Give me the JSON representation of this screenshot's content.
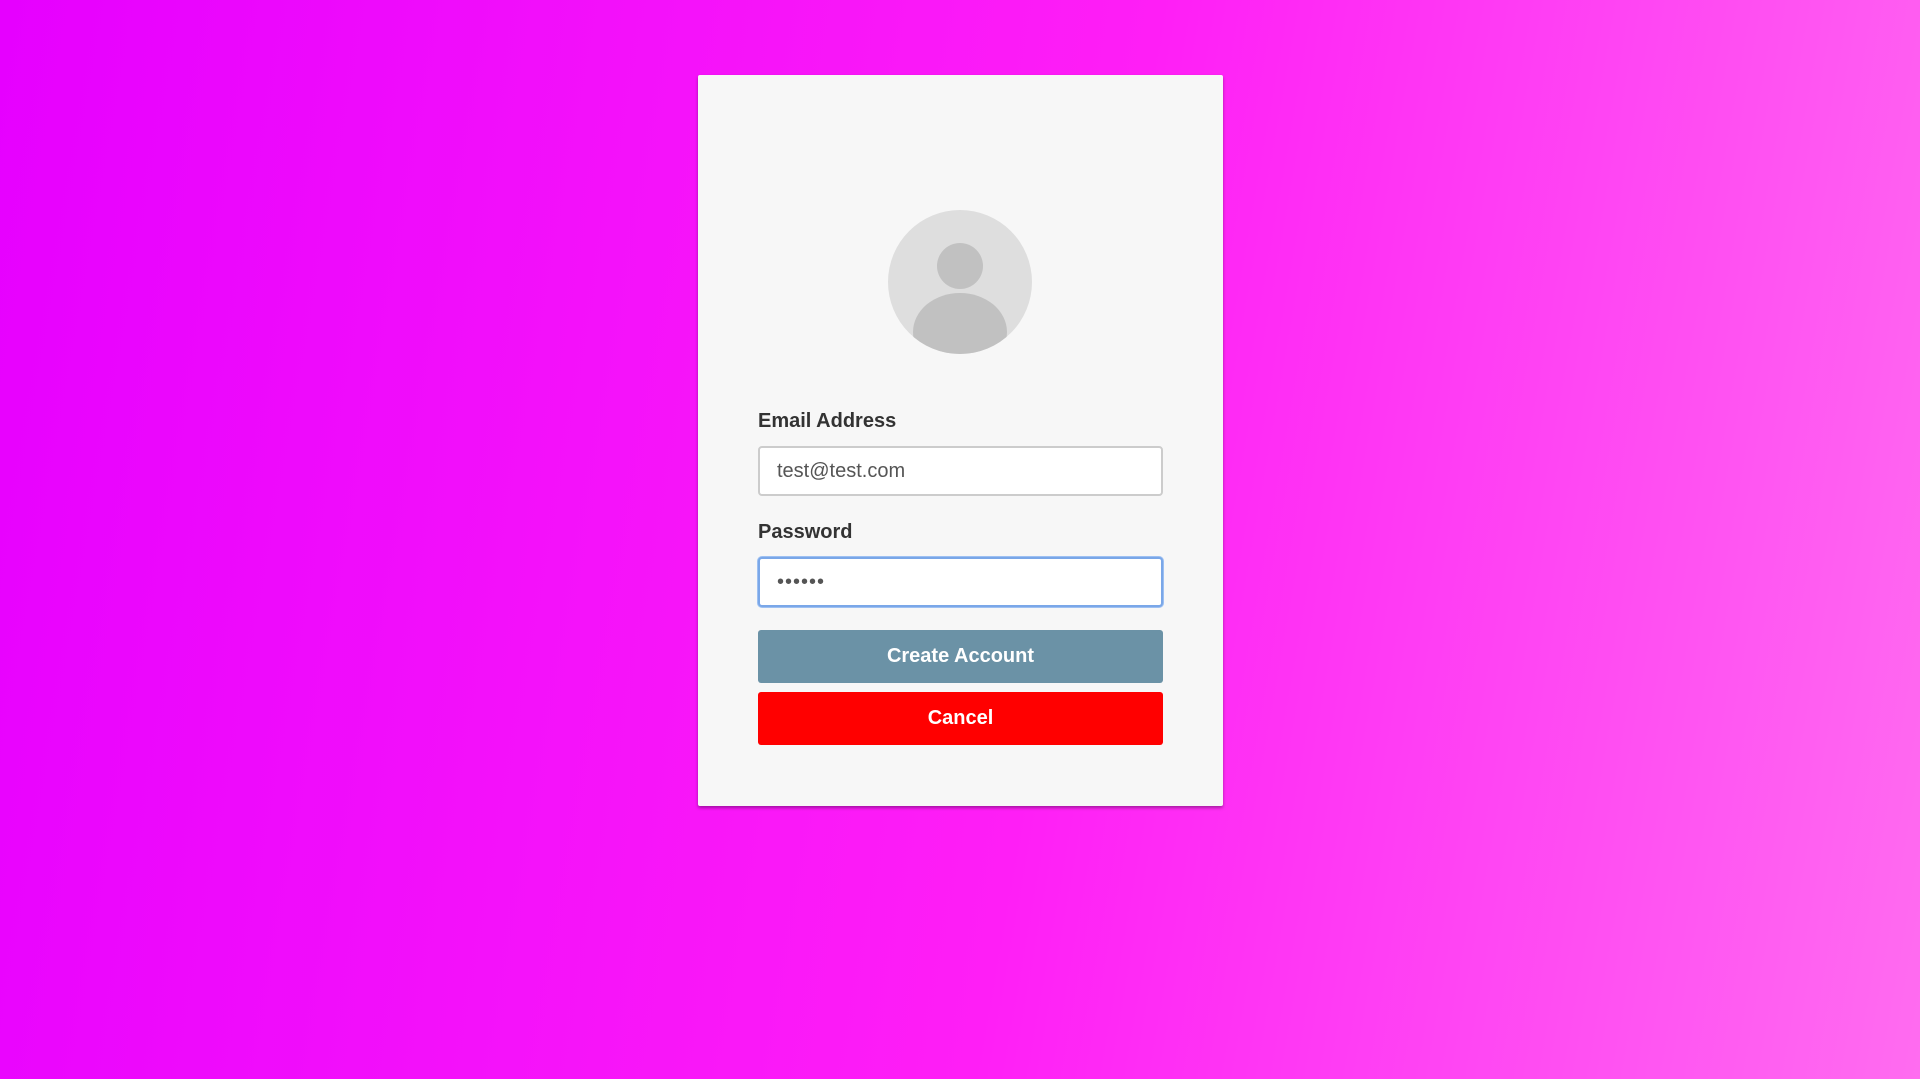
{
  "form": {
    "email_label": "Email Address",
    "email_value": "test@test.com",
    "password_label": "Password",
    "password_value": "••••••",
    "create_button_label": "Create Account",
    "cancel_button_label": "Cancel"
  },
  "avatar": {
    "icon": "user-icon"
  },
  "colors": {
    "background_start": "#e600ff",
    "background_end": "#ff6cf0",
    "card": "#f7f7f7",
    "create_button": "#6b92a6",
    "cancel_button": "#ff0000",
    "focus_border": "#7aa7e8"
  }
}
